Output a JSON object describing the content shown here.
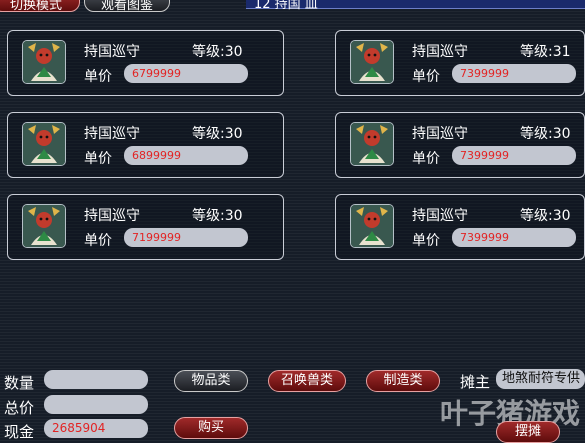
{
  "top_bar": {
    "switch_mode_label": "切换模式",
    "view_catalog_label": "观看图鉴",
    "header_text": "12 持国 皿"
  },
  "listings": [
    {
      "name": "持国巡守",
      "level": "等级:30",
      "price_label": "单价",
      "price": "6799999"
    },
    {
      "name": "持国巡守",
      "level": "等级:31",
      "price_label": "单价",
      "price": "7399999"
    },
    {
      "name": "持国巡守",
      "level": "等级:30",
      "price_label": "单价",
      "price": "6899999"
    },
    {
      "name": "持国巡守",
      "level": "等级:30",
      "price_label": "单价",
      "price": "7399999"
    },
    {
      "name": "持国巡守",
      "level": "等级:30",
      "price_label": "单价",
      "price": "7199999"
    },
    {
      "name": "持国巡守",
      "level": "等级:30",
      "price_label": "单价",
      "price": "7399999"
    }
  ],
  "bottom": {
    "quantity_label": "数量",
    "quantity_value": "",
    "total_label": "总价",
    "total_value": "",
    "cash_label": "现金",
    "cash_value": "2685904",
    "items_btn": "物品类",
    "summon_btn": "召唤兽类",
    "crafting_btn": "制造类",
    "buy_btn": "购买",
    "stall_owner_label": "摊主",
    "stall_owner_value": "地煞耐符专供",
    "watermark": "叶子猪游戏",
    "stall_btn": "摆摊"
  },
  "colors": {
    "price_text": "#e22424",
    "field_bg": "#c2c6d0",
    "button_red": "#7a1414"
  }
}
